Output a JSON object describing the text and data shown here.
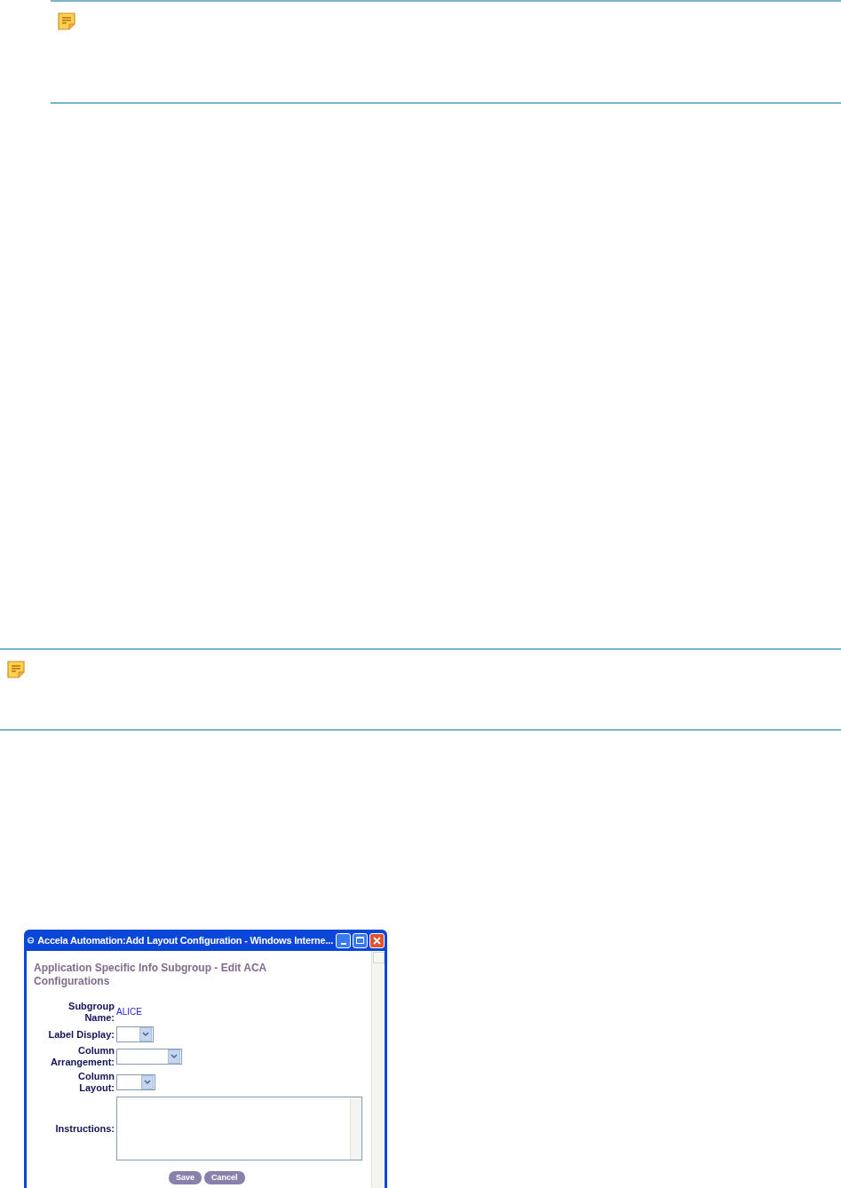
{
  "notes": [
    {
      "kind": "note"
    },
    {
      "kind": "note"
    }
  ],
  "window": {
    "title": "Accela Automation:Add Layout Configuration - Windows Interne...",
    "heading": "Application Specific Info Subgroup - Edit ACA Configurations",
    "fields": [
      {
        "kind": "text",
        "label": "Subgroup Name:",
        "value": "ALICE"
      },
      {
        "kind": "select",
        "label": "Label Display:"
      },
      {
        "kind": "select",
        "label": "Column Arrangement:"
      },
      {
        "kind": "select",
        "label": "Column Layout:"
      },
      {
        "kind": "textarea",
        "label": "Instructions:"
      }
    ],
    "buttons": [
      "Save",
      "Cancel"
    ]
  }
}
